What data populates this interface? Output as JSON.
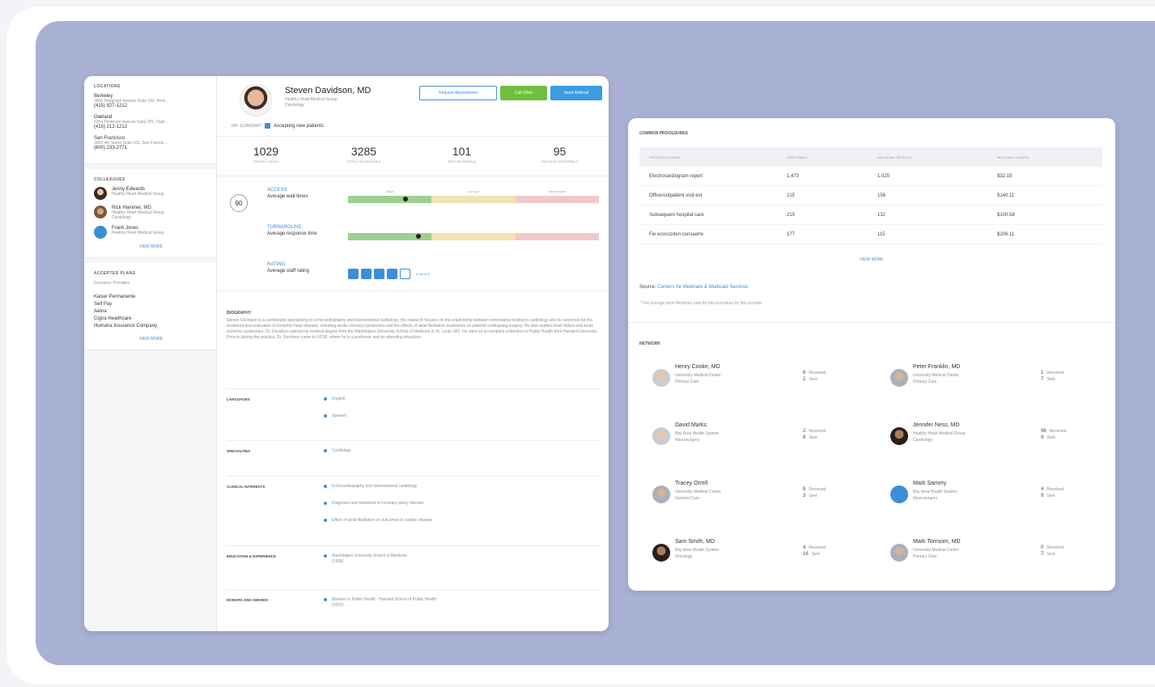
{
  "sidebar": {
    "locations_head": "LOCATIONS",
    "locations": [
      {
        "city": "Berkeley",
        "address": "2636 Telegraph Avenue Suite 102, Berk...",
        "phone": "(415) 827-1212"
      },
      {
        "city": "Oakland",
        "address": "5354 Piedmont Avenue Suite 201, Oakl...",
        "phone": "(415) 212-1212"
      },
      {
        "city": "San Francisco",
        "address": "1825 4th Street Suite 101, San Francis...",
        "phone": "(800) 233-2771"
      }
    ],
    "colleagues_head": "COLLEAGUES",
    "colleagues": [
      {
        "name": "Jenny Edwards",
        "sub1": "Healthy Heart Medical Group",
        "sub2": ""
      },
      {
        "name": "Rick Hammer, MD",
        "sub1": "Healthy Heart Medical Group",
        "sub2": "Cardiology"
      },
      {
        "name": "Frank Jones",
        "sub1": "Healthy Heart Medical Group",
        "sub2": ""
      }
    ],
    "colleagues_link": "VIEW MORE",
    "plans_head": "ACCEPTED PLANS",
    "plans_sub": "Insurance Providers",
    "plans": [
      "Kaiser Permanente",
      "Self Pay",
      "Aetna",
      "Cigna Healthcare",
      "Humana Insurance Company"
    ],
    "plans_link": "VIEW MORE"
  },
  "doctor": {
    "name": "Steven Davidson, MD",
    "group": "Healthy Heart Medical Group",
    "specialty": "Cardiology",
    "npi": "NPI 1134829497",
    "accepting": "Accepting new patients",
    "btn_outline": "Request Appointment",
    "btn_green": "Call Clinic",
    "btn_blue": "Send Referral"
  },
  "stats": [
    {
      "num": "1029",
      "label": "PROFILE VIEWS"
    },
    {
      "num": "3285",
      "label": "TOTAL PROCEDURES"
    },
    {
      "num": "101",
      "label": "SENT REFERRALS"
    },
    {
      "num": "95",
      "label": "RECEIVED REFERRALS"
    }
  ],
  "scores": {
    "overall": "90",
    "segment_labels": [
      "Good",
      "Average",
      "Needs work"
    ],
    "access": {
      "title": "ACCESS",
      "sub": "Average wait times",
      "level": 0.23
    },
    "turnaround": {
      "title": "TURNAROUND",
      "sub": "Average response time",
      "level": 0.28
    },
    "rating": {
      "title": "RATING",
      "sub": "Average staff rating",
      "filled": 4,
      "total": 5,
      "note": "4 out of 5"
    }
  },
  "bio": {
    "head": "BIOGRAPHY",
    "text": "Steven Davidson is a cardiologist specializing in echocardiography and interventional cardiology. His research focuses on the relationship between noninvasive testing in cardiology and its outcomes for the treatment and evaluation of ischemic heart disease, including acute coronary syndromes and the effects of atrial fibrillation treatments on patients undergoing surgery. He also studies heart failure and acute ischemic syndromes. Dr. Davidson earned his medical degree from the Washington University School of Medicine in St. Louis, MO. He went on to complete a Masters in Public Health from Harvard University. Prior to joining the practice, Dr. Davidson came to UCSF, where he is a professor and an attending physician."
  },
  "sections": [
    {
      "head": "LANGUAGES",
      "items": [
        "English",
        "Spanish"
      ]
    },
    {
      "head": "SPECIALTIES",
      "items": [
        "Cardiology"
      ]
    },
    {
      "head": "CLINICAL INTERESTS",
      "items": [
        "Echocardiography and interventional cardiology",
        "Diagnosis and treatment of coronary artery disease",
        "Effect of atrial fibrillation on outcomes in cardiac disease"
      ]
    },
    {
      "head": "EDUCATION & EXPERIENCE",
      "items": [
        "Washington University School of Medicine",
        "(1998)"
      ]
    },
    {
      "head": "HONORS AND AWARDS",
      "items": [
        "Masters in Public Health - Harvard School of Public Health",
        "(2003)"
      ]
    }
  ],
  "procedures": {
    "head": "COMMON PROCEDURES",
    "columns": [
      "PROCEDURE NAME",
      "PERFORMED",
      "INDIVIDUAL PATIENTS",
      "MEDICARE CHARGE"
    ],
    "rows": [
      [
        "Electrocardiogram report",
        "1,473",
        "1,025",
        "$32.15"
      ],
      [
        "Office/outpatient visit est",
        "215",
        "156",
        "$140.11"
      ],
      [
        "Subsequent hospital care",
        "215",
        "132",
        "$100.58"
      ],
      [
        "Fie ecocozden consaerte",
        "177",
        "115",
        "$206.11"
      ]
    ],
    "more": "VIEW MORE",
    "source_label": "Source:",
    "source_link": "Centers for Medicare & Medicaid Services",
    "footnote": "* The average price Medicare paid for this procedure by this provider"
  },
  "network": {
    "head": "NETWORK",
    "items": [
      {
        "name": "Henry Cooke, MD",
        "sub1": "University Medical Center",
        "sub2": "Primary Care",
        "n1": "6",
        "l1": "Received",
        "n2": "2",
        "l2": "Sent"
      },
      {
        "name": "Peter Franklin, MD",
        "sub1": "University Medical Center",
        "sub2": "Primary Care",
        "n1": "1",
        "l1": "Received",
        "n2": "7",
        "l2": "Sent"
      },
      {
        "name": "David Marks",
        "sub1": "Bay Area Health System",
        "sub2": "Neurosurgery",
        "n1": "2",
        "l1": "Received",
        "n2": "8",
        "l2": "Sent"
      },
      {
        "name": "Jennifer Ness, MD",
        "sub1": "Healthy Heart Medical Group",
        "sub2": "Cardiology",
        "n1": "96",
        "l1": "Received",
        "n2": "9",
        "l2": "Sent"
      },
      {
        "name": "Tracey Orrell",
        "sub1": "University Medical Center",
        "sub2": "General Care",
        "n1": "8",
        "l1": "Received",
        "n2": "3",
        "l2": "Sent"
      },
      {
        "name": "Mark Sammy",
        "sub1": "Bay Area Health System",
        "sub2": "Neurosurgery",
        "n1": "4",
        "l1": "Received",
        "n2": "9",
        "l2": "Sent"
      },
      {
        "name": "Sam Smith, MD",
        "sub1": "Bay Area Health System",
        "sub2": "Oncology",
        "n1": "4",
        "l1": "Received",
        "n2": "16",
        "l2": "Sent"
      },
      {
        "name": "Mark Tomsom, MD",
        "sub1": "University Medical Center",
        "sub2": "Primary Care",
        "n1": "0",
        "l1": "Received",
        "n2": "7",
        "l2": "Sent"
      }
    ]
  },
  "colors": {
    "accent": "#3d8ed8",
    "green": "#6fbf3f",
    "panel": "#a9b1d4"
  }
}
